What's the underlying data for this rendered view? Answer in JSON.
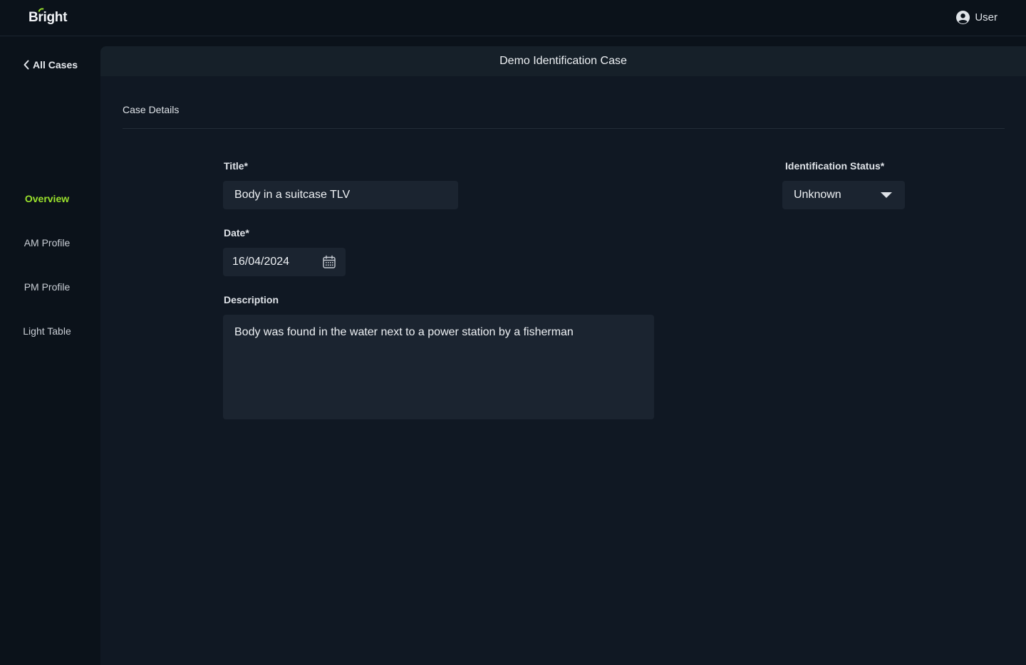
{
  "app": {
    "logo": "Bright",
    "user_label": "User"
  },
  "sidebar": {
    "back_label": "All Cases",
    "items": [
      {
        "label": "Overview",
        "active": true
      },
      {
        "label": "AM Profile",
        "active": false
      },
      {
        "label": "PM Profile",
        "active": false
      },
      {
        "label": "Light Table",
        "active": false
      }
    ]
  },
  "case": {
    "header_title": "Demo Identification Case",
    "section_title": "Case Details"
  },
  "form": {
    "title_label": "Title*",
    "title_value": "Body in a suitcase TLV",
    "status_label": "Identification Status*",
    "status_value": "Unknown",
    "date_label": "Date*",
    "date_value": "16/04/2024",
    "description_label": "Description",
    "description_value": "Body was found in the water next to a power station by a fisherman"
  },
  "colors": {
    "accent": "#9be22c",
    "background": "#0b121a",
    "panel": "#101823",
    "field": "#1b2430"
  }
}
